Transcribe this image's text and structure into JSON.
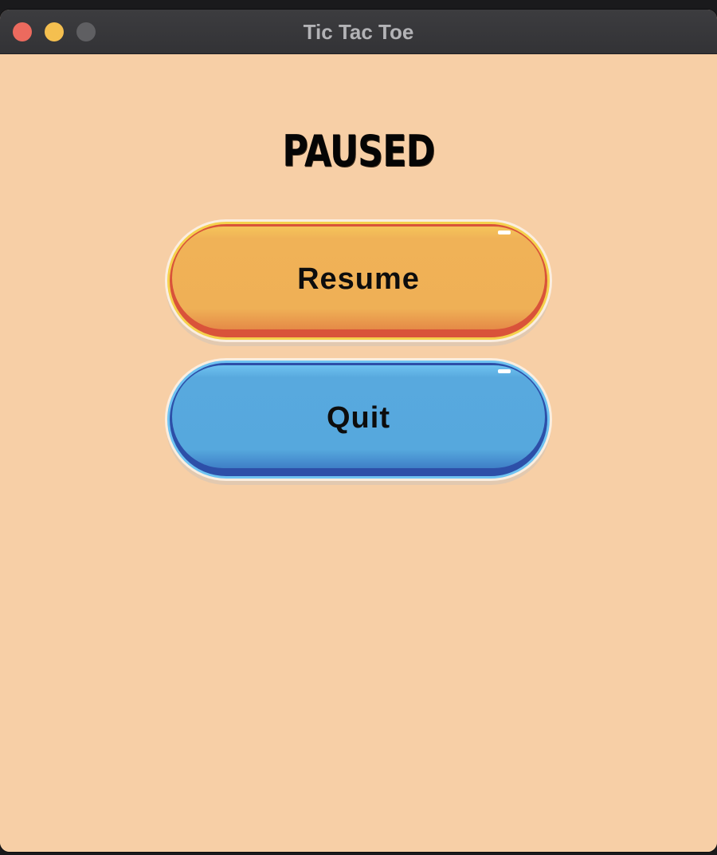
{
  "window": {
    "title": "Tic Tac Toe",
    "traffic_lights": {
      "close_color": "#ec6a5e",
      "minimize_color": "#f4bf4f",
      "zoom_color": "#5f5f62"
    }
  },
  "pause_menu": {
    "title": "PAUSED",
    "resume_label": "Resume",
    "quit_label": "Quit"
  },
  "colors": {
    "background": "#f7cfa6",
    "resume_button": "#efb056",
    "quit_button": "#56a8dd"
  }
}
